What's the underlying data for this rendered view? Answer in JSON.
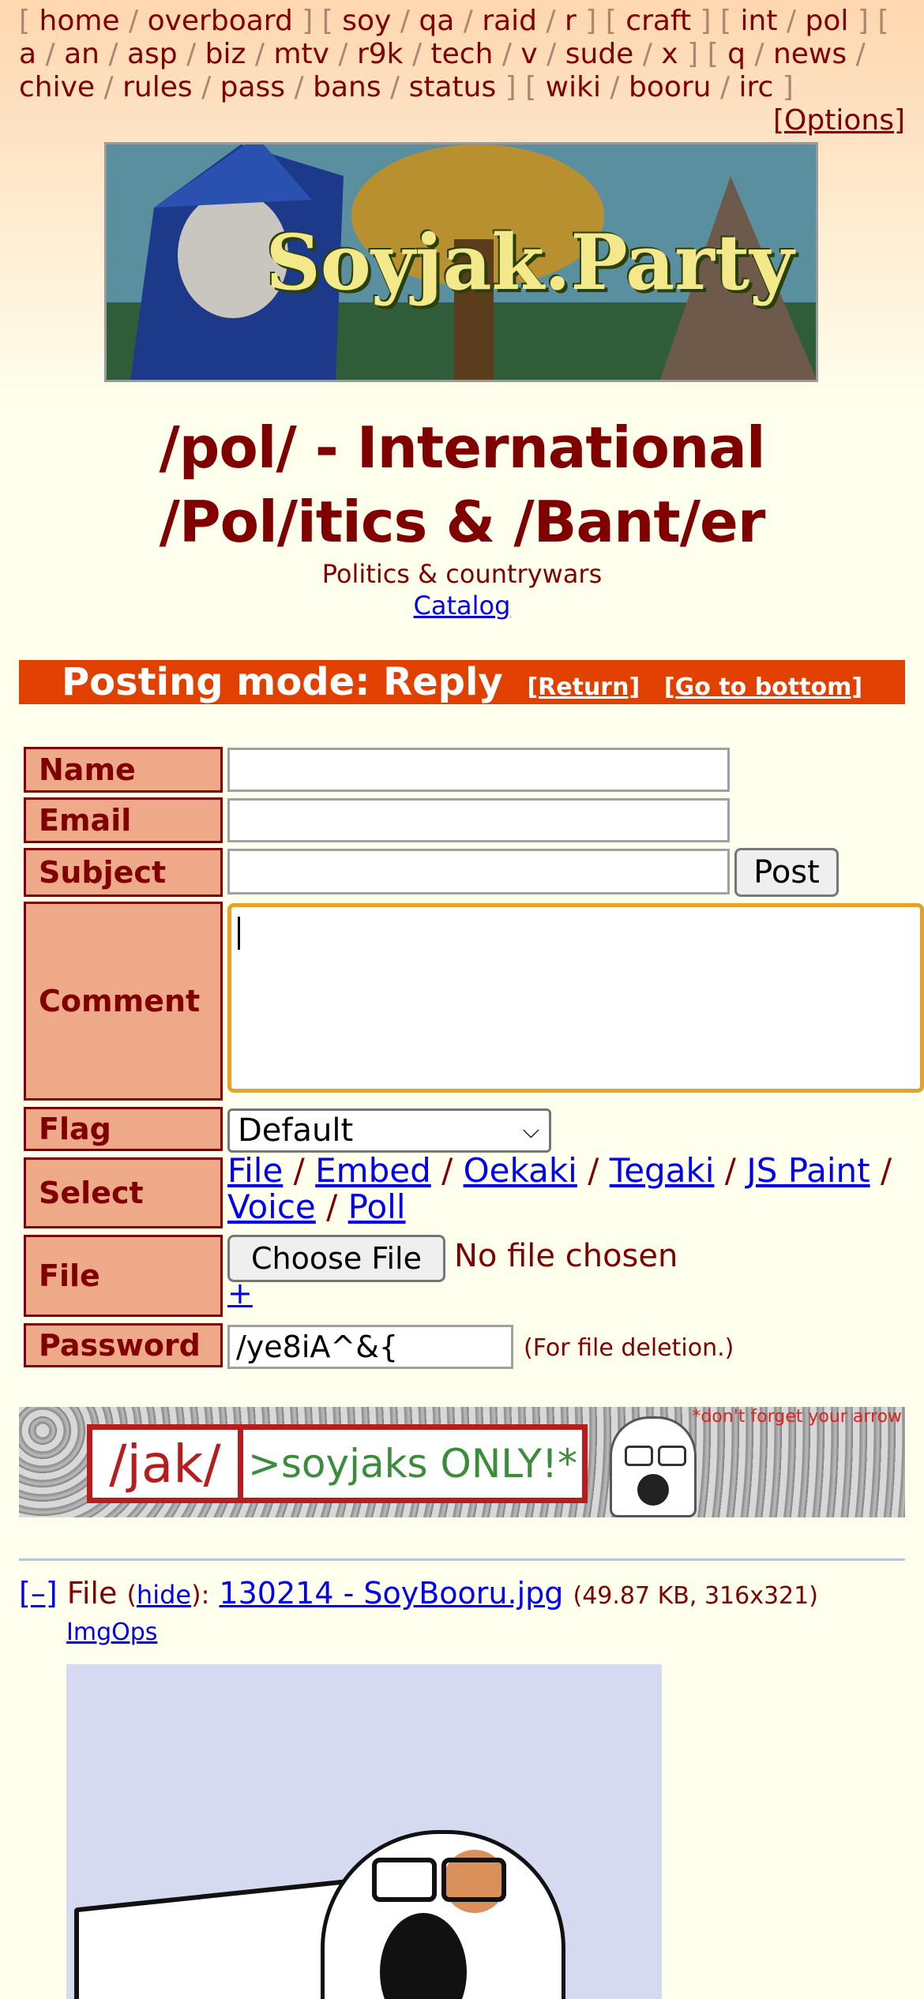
{
  "nav": {
    "groups": [
      [
        "home",
        "overboard"
      ],
      [
        "soy",
        "qa",
        "raid",
        "r"
      ],
      [
        "craft"
      ],
      [
        "int",
        "pol"
      ],
      [
        "a",
        "an",
        "asp",
        "biz",
        "mtv",
        "r9k",
        "tech",
        "v",
        "sude",
        "x"
      ],
      [
        "q",
        "news",
        "chive",
        "rules",
        "pass",
        "bans",
        "status"
      ],
      [
        "wiki",
        "booru",
        "irc"
      ]
    ],
    "options": "[Options]"
  },
  "banner": {
    "text": "Soyjak.Party"
  },
  "board": {
    "title": "/pol/ - International /Pol/itics & /Bant/er",
    "subtitle": "Politics & countrywars",
    "catalog": "Catalog"
  },
  "posting_mode": {
    "label": "Posting mode: Reply",
    "return": "[Return]",
    "bottom": "[Go to bottom]",
    "bar_color": "#e04000"
  },
  "form": {
    "name_label": "Name",
    "email_label": "Email",
    "subject_label": "Subject",
    "post_button": "Post",
    "comment_label": "Comment",
    "flag_label": "Flag",
    "flag_value": "Default",
    "select_label": "Select",
    "select_options": [
      "File",
      "Embed",
      "Oekaki",
      "Tegaki",
      "JS Paint",
      "Voice",
      "Poll"
    ],
    "file_label": "File",
    "choose_file": "Choose File",
    "no_file": "No file chosen",
    "add_file": "+",
    "password_label": "Password",
    "password_value": "/ye8iA^&{",
    "password_note": "(For file deletion.)"
  },
  "ad": {
    "board": "/jak/",
    "tagline": ">soyjaks ONLY!*",
    "footnote": "*don't forget your arrow"
  },
  "post": {
    "collapse": "[–]",
    "file_word": "File",
    "hide": "hide",
    "filename": "130214 - SoyBooru.jpg",
    "icon": "",
    "meta": "(49.87 KB, 316x321)",
    "imgops": "ImgOps"
  }
}
